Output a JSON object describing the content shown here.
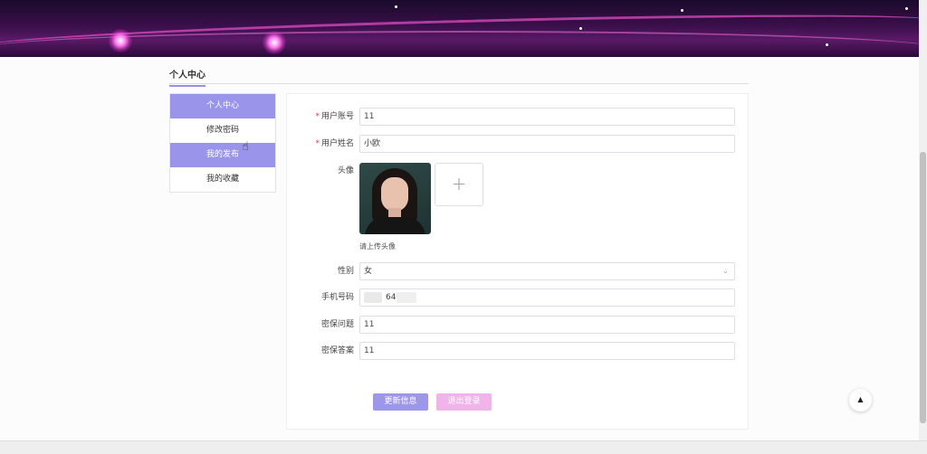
{
  "banner": {
    "colors": {
      "base": "#3a0f4a",
      "accent": "#e650c8"
    }
  },
  "header": {
    "title": "个人中心"
  },
  "sidebar": {
    "items": [
      {
        "label": "个人中心",
        "active": true
      },
      {
        "label": "修改密码",
        "active": false
      },
      {
        "label": "我的发布",
        "active": true
      },
      {
        "label": "我的收藏",
        "active": false
      }
    ]
  },
  "form": {
    "account": {
      "label": "用户账号",
      "value": "11",
      "required": true
    },
    "name": {
      "label": "用户姓名",
      "value": "小欧",
      "required": true
    },
    "avatar": {
      "label": "头像",
      "hint": "请上传头像",
      "upload_icon": "plus-icon"
    },
    "gender": {
      "label": "性别",
      "value": "女",
      "icon": "chevron-down-icon"
    },
    "phone": {
      "label": "手机号码",
      "value": "645"
    },
    "security_question": {
      "label": "密保问题",
      "value": "11"
    },
    "security_answer": {
      "label": "密保答案",
      "value": "11"
    }
  },
  "actions": {
    "update_label": "更新信息",
    "logout_label": "退出登录"
  },
  "back_to_top": {
    "icon": "caret-up-icon",
    "glyph": "▲"
  },
  "colors": {
    "primary": "#9d97ea",
    "secondary": "#f2b3ea",
    "required": "#e04040"
  }
}
